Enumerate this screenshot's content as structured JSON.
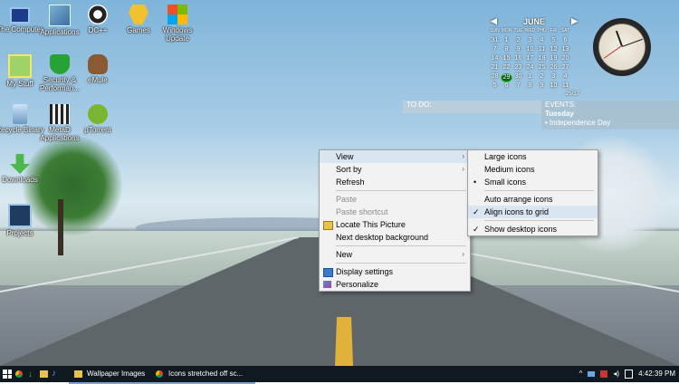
{
  "desktop": {
    "icons": [
      {
        "label": "The Computer"
      },
      {
        "label": "Applications"
      },
      {
        "label": "DC++"
      },
      {
        "label": "Games"
      },
      {
        "label": "Windows Update"
      },
      {
        "label": "My Stuff"
      },
      {
        "label": "Security & Performan..."
      },
      {
        "label": "eMule"
      },
      {
        "label": "Recycle Binary"
      },
      {
        "label": "MetaD Applications"
      },
      {
        "label": "µTorrent"
      },
      {
        "label": "Downloads"
      },
      {
        "label": "Projects"
      }
    ]
  },
  "calendar": {
    "month": "JUNE",
    "weekdays": [
      "SUN",
      "MON",
      "TUE",
      "WED",
      "THU",
      "FRI",
      "SAT"
    ],
    "days": [
      "31",
      "1",
      "2",
      "3",
      "4",
      "5",
      "6",
      "7",
      "8",
      "9",
      "10",
      "11",
      "12",
      "13",
      "14",
      "15",
      "16",
      "17",
      "18",
      "19",
      "20",
      "21",
      "22",
      "23",
      "24",
      "25",
      "26",
      "27",
      "28",
      "29",
      "30",
      "1",
      "2",
      "3",
      "4",
      "5",
      "6",
      "7",
      "8",
      "9",
      "10",
      "11"
    ],
    "today": "29",
    "week_label": "25/17"
  },
  "widgets": {
    "todo_label": "TO DO:",
    "events_label": "EVENTS:",
    "event_day": "Tuesday",
    "event_name": "• Independence Day"
  },
  "context_menu": {
    "view": "View",
    "sort_by": "Sort by",
    "refresh": "Refresh",
    "paste": "Paste",
    "paste_shortcut": "Paste shortcut",
    "locate_picture": "Locate This Picture",
    "next_background": "Next desktop background",
    "new": "New",
    "display_settings": "Display settings",
    "personalize": "Personalize"
  },
  "view_submenu": {
    "large_icons": "Large icons",
    "medium_icons": "Medium icons",
    "small_icons": "Small icons",
    "auto_arrange": "Auto arrange icons",
    "align_grid": "Align icons to grid",
    "show_desktop_icons": "Show desktop icons",
    "bullet": "•",
    "check": "✓"
  },
  "taskbar": {
    "app1": "Wallpaper Images",
    "app2": "Icons stretched off sc...",
    "time": "4:42:39 PM",
    "start_icon": "windows-start-icon"
  },
  "colors": {
    "highlight": "#d9e5f1",
    "taskbar": "#101820",
    "accent": "#7aa6d6"
  }
}
